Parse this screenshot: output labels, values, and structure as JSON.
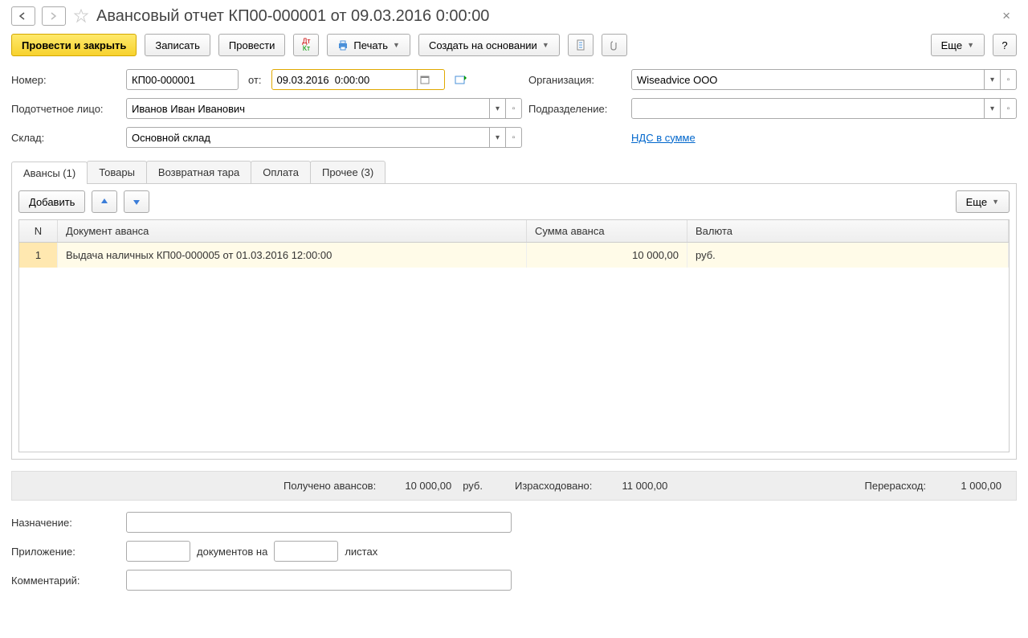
{
  "header": {
    "title": "Авансовый отчет КП00-000001 от 09.03.2016 0:00:00"
  },
  "toolbar": {
    "post_close": "Провести и закрыть",
    "save": "Записать",
    "post": "Провести",
    "print": "Печать",
    "create_based": "Создать на основании",
    "more": "Еще",
    "help": "?"
  },
  "form": {
    "number_label": "Номер:",
    "number_value": "КП00-000001",
    "from_label": "от:",
    "date_value": "09.03.2016  0:00:00",
    "org_label": "Организация:",
    "org_value": "Wiseadvice ООО",
    "person_label": "Подотчетное лицо:",
    "person_value": "Иванов Иван Иванович",
    "dept_label": "Подразделение:",
    "dept_value": "",
    "warehouse_label": "Склад:",
    "warehouse_value": "Основной склад",
    "vat_link": "НДС в сумме"
  },
  "tabs": {
    "advances": "Авансы (1)",
    "goods": "Товары",
    "return_tare": "Возвратная тара",
    "payment": "Оплата",
    "other": "Прочее (3)"
  },
  "table_toolbar": {
    "add": "Добавить",
    "more": "Еще"
  },
  "table": {
    "col_n": "N",
    "col_doc": "Документ аванса",
    "col_sum": "Сумма аванса",
    "col_cur": "Валюта",
    "rows": [
      {
        "n": "1",
        "doc": "Выдача наличных КП00-000005 от 01.03.2016 12:00:00",
        "sum": "10 000,00",
        "cur": "руб."
      }
    ]
  },
  "summary": {
    "received_label": "Получено авансов:",
    "received_value": "10 000,00",
    "received_cur": "руб.",
    "spent_label": "Израсходовано:",
    "spent_value": "11 000,00",
    "over_label": "Перерасход:",
    "over_value": "1 000,00"
  },
  "bottom": {
    "purpose_label": "Назначение:",
    "attach_label": "Приложение:",
    "docs_text": "документов на",
    "sheets_text": "листах",
    "comment_label": "Комментарий:"
  }
}
